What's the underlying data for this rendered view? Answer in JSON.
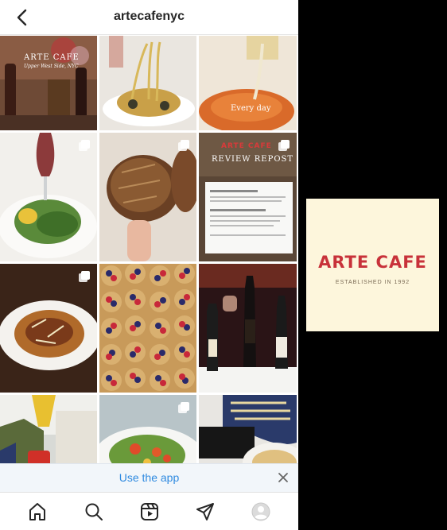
{
  "header": {
    "title": "artecafenyc"
  },
  "posts": [
    {
      "overlay_title": "ARTE CAFE",
      "overlay_sub": "Upper West Side, NYC"
    },
    {},
    {
      "overlay": "Every day"
    },
    {},
    {},
    {
      "overlay_title": "ARTE CAFE",
      "overlay_sub": "REVIEW REPOST"
    },
    {},
    {},
    {},
    {},
    {},
    {}
  ],
  "banner": {
    "use_app_label": "Use the app"
  },
  "logo": {
    "name": "ARTE CAFE",
    "tagline": "ESTABLISHED IN 1992"
  },
  "icons": {
    "back": "chevron-left-icon",
    "multi": "carousel-icon",
    "close": "close-icon",
    "home": "home-icon",
    "search": "search-icon",
    "reels": "reels-icon",
    "send": "send-icon",
    "profile": "avatar-icon"
  }
}
